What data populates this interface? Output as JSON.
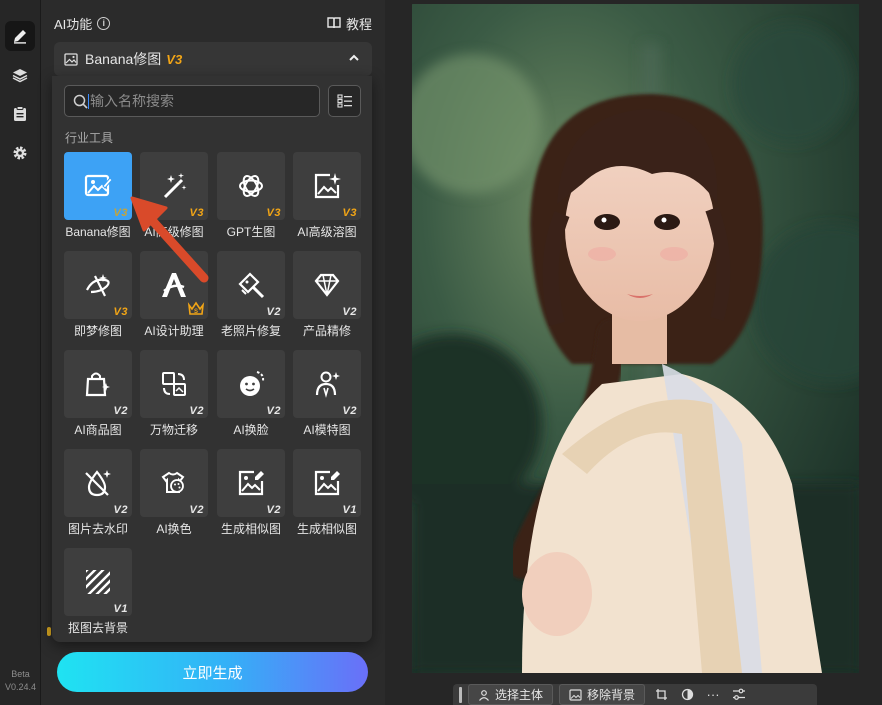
{
  "panel": {
    "title": "AI功能",
    "tutorial": "教程",
    "group_label": "Banana修图",
    "group_version": "V3"
  },
  "search": {
    "placeholder": "输入名称搜索"
  },
  "section_label": "行业工具",
  "tools": [
    {
      "name": "Banana修图",
      "version": "V3",
      "icon": "image-edit-icon",
      "active": true
    },
    {
      "name": "AI高级修图",
      "version": "V3",
      "icon": "magic-wand-icon"
    },
    {
      "name": "GPT生图",
      "version": "V3",
      "icon": "gpt-knot-icon"
    },
    {
      "name": "AI高级溶图",
      "version": "V3",
      "icon": "image-sparkle-icon"
    },
    {
      "name": "即梦修图",
      "version": "V3",
      "icon": "dream-swirl-icon"
    },
    {
      "name": "AI设计助理",
      "version": "",
      "icon": "letter-a-icon",
      "crown": true
    },
    {
      "name": "老照片修复",
      "version": "V2",
      "icon": "photo-repair-icon"
    },
    {
      "name": "产品精修",
      "version": "V2",
      "icon": "diamond-icon"
    },
    {
      "name": "AI商品图",
      "version": "V2",
      "icon": "shopping-bag-icon"
    },
    {
      "name": "万物迁移",
      "version": "V2",
      "icon": "transfer-icon"
    },
    {
      "name": "AI换脸",
      "version": "V2",
      "icon": "face-swap-icon"
    },
    {
      "name": "AI模特图",
      "version": "V2",
      "icon": "model-person-icon"
    },
    {
      "name": "图片去水印",
      "version": "V2",
      "icon": "remove-watermark-icon"
    },
    {
      "name": "AI换色",
      "version": "V2",
      "icon": "shirt-palette-icon"
    },
    {
      "name": "生成相似图",
      "version": "V2",
      "icon": "similar-image-icon"
    },
    {
      "name": "生成相似图",
      "version": "V1",
      "icon": "similar-image-icon"
    },
    {
      "name": "抠图去背景",
      "version": "V1",
      "icon": "remove-background-icon"
    }
  ],
  "generate_button": "立即生成",
  "rail": {
    "version_line1": "Beta",
    "version_line2": "V0.24.4"
  },
  "canvas_toolbar": {
    "select_subject": "选择主体",
    "remove_background": "移除背景",
    "more": "···"
  },
  "colors": {
    "accent_blue": "#3da2f5",
    "version_orange": "#f2a516",
    "gradient_start": "#1fe3f2",
    "gradient_end": "#6a6ff8"
  }
}
